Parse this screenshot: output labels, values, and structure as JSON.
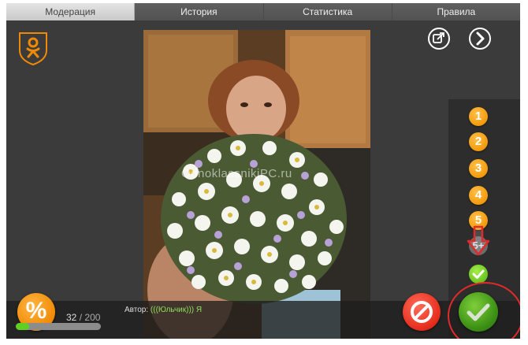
{
  "tabs": [
    {
      "label": "Модерация",
      "active": true
    },
    {
      "label": "История",
      "active": false
    },
    {
      "label": "Статистика",
      "active": false
    },
    {
      "label": "Правила",
      "active": false
    }
  ],
  "icons": {
    "logo": "odnoklassniki-logo-icon",
    "top_right": [
      "share-icon",
      "next-arrow-icon"
    ]
  },
  "photo": {
    "watermark": "OdnoklassnikiPC.ru"
  },
  "ratings": [
    "1",
    "2",
    "3",
    "4",
    "5"
  ],
  "rating_plus": "5+",
  "progress": {
    "current": "32",
    "separator": "/",
    "total": "200",
    "fraction": 0.16
  },
  "percent_label": "%",
  "author": {
    "label": "Автор:",
    "name": "(((Юльчик))) Я"
  },
  "colors": {
    "accent_orange": "#f39a0b",
    "approve_green": "#3a8f14",
    "reject_red": "#e8301f",
    "highlight_red": "#e22a2a"
  }
}
